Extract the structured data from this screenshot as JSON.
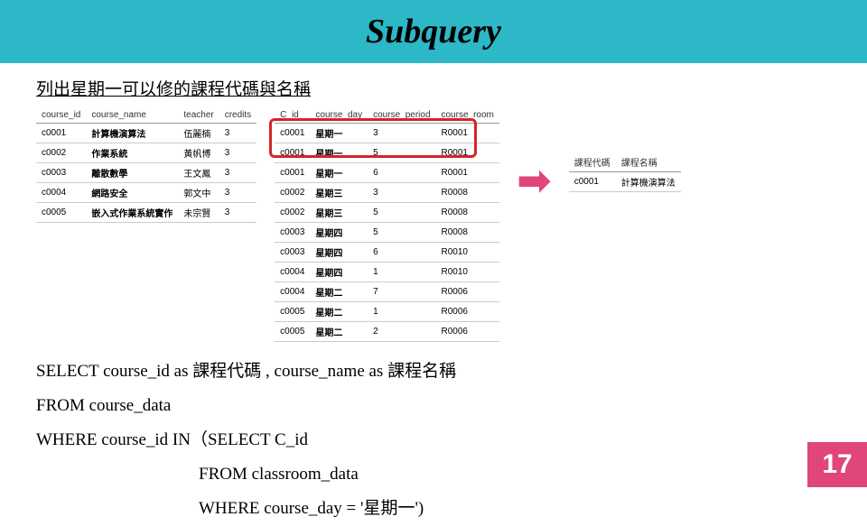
{
  "title": "Subquery",
  "question": "列出星期一可以修的課程代碼與名稱",
  "page_number": "17",
  "arrow_glyph": "➡",
  "table1": {
    "headers": [
      "course_id",
      "course_name",
      "teacher",
      "credits"
    ],
    "rows": [
      [
        "c0001",
        "計算機演算法",
        "伍麗楠",
        "3"
      ],
      [
        "c0002",
        "作業系統",
        "黃帆博",
        "3"
      ],
      [
        "c0003",
        "離散數學",
        "王文鳳",
        "3"
      ],
      [
        "c0004",
        "網路安全",
        "郭文中",
        "3"
      ],
      [
        "c0005",
        "嵌入式作業系統實作",
        "未宗賢",
        "3"
      ]
    ]
  },
  "table2": {
    "headers": [
      "C_id",
      "course_day",
      "course_period",
      "course_room"
    ],
    "rows": [
      [
        "c0001",
        "星期一",
        "3",
        "R0001"
      ],
      [
        "c0001",
        "星期一",
        "5",
        "R0001"
      ],
      [
        "c0001",
        "星期一",
        "6",
        "R0001"
      ],
      [
        "c0002",
        "星期三",
        "3",
        "R0008"
      ],
      [
        "c0002",
        "星期三",
        "5",
        "R0008"
      ],
      [
        "c0003",
        "星期四",
        "5",
        "R0008"
      ],
      [
        "c0003",
        "星期四",
        "6",
        "R0010"
      ],
      [
        "c0004",
        "星期四",
        "1",
        "R0010"
      ],
      [
        "c0004",
        "星期二",
        "7",
        "R0006"
      ],
      [
        "c0005",
        "星期二",
        "1",
        "R0006"
      ],
      [
        "c0005",
        "星期二",
        "2",
        "R0006"
      ]
    ]
  },
  "table3": {
    "headers": [
      "課程代碼",
      "課程名稱"
    ],
    "rows": [
      [
        "c0001",
        "計算機演算法"
      ]
    ]
  },
  "sql": {
    "line1": "SELECT course_id as 課程代碼 , course_name as 課程名稱",
    "line2": "FROM course_data",
    "line3": "WHERE course_id IN（SELECT C_id",
    "line4": "FROM classroom_data",
    "line5": "WHERE course_day = '星期一')"
  }
}
